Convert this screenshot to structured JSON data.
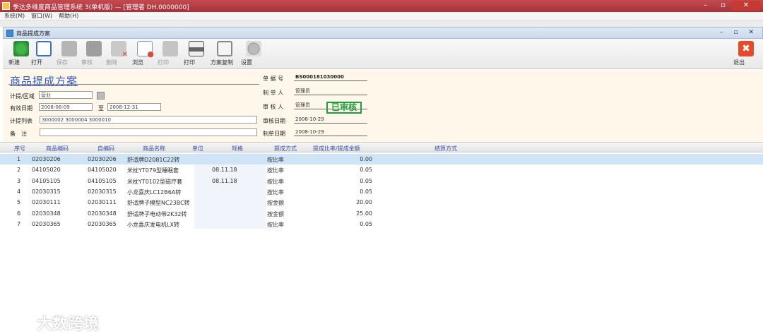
{
  "window": {
    "title": "季达多维度商品管理系统 3(单机版) — [管理者 DH.0000000]"
  },
  "menu": [
    "系统(M)",
    "窗口(W)",
    "帮助(H)"
  ],
  "subwindow": {
    "title": "商品提成方案",
    "controls": "– ▫ ✕"
  },
  "toolbar": {
    "buttons": [
      {
        "label": "新建",
        "icon": "new-doc-icon",
        "enabled": true
      },
      {
        "label": "打开",
        "icon": "open-doc-icon",
        "enabled": true
      },
      {
        "label": "保存",
        "icon": "save-icon",
        "enabled": false
      },
      {
        "label": "审核",
        "icon": "audit-icon",
        "enabled": false
      },
      {
        "label": "删除",
        "icon": "delete-icon",
        "enabled": false
      },
      {
        "label": "浏览",
        "icon": "browse-icon",
        "enabled": true
      },
      {
        "label": "打印",
        "icon": "print-disabled-icon",
        "enabled": false
      },
      {
        "label": "打印",
        "icon": "printer-icon",
        "enabled": true
      },
      {
        "label": "方案复制",
        "icon": "copy-scheme-icon",
        "enabled": true
      },
      {
        "label": "设置",
        "icon": "settings-icon",
        "enabled": true
      }
    ],
    "exit_label": "退出"
  },
  "form": {
    "doc_title": "商品提成方案",
    "labels": {
      "object": "计提/区域",
      "valid_date": "有效日期",
      "to": "至",
      "object_list": "计提列表",
      "remark": "备　注",
      "doc_no": "单 据 号",
      "maker": "制 单 人",
      "auditor": "审 核 人",
      "audit_date": "审核日期",
      "make_date": "制单日期"
    },
    "values": {
      "object": "营业",
      "date_from": "2008-06-09",
      "date_to": "2008-12-31",
      "object_list": "3000002 3000004 3000010",
      "remark": "",
      "doc_no": "BS000181030000",
      "maker": "管理员",
      "auditor": "管理员",
      "audit_date": "2008-10-29",
      "make_date": "2008-10-29"
    },
    "status_stamp": "已审核"
  },
  "grid": {
    "columns": [
      "序号",
      "商品编码",
      "自编码",
      "商品名称",
      "单位",
      "规格",
      "提成方式",
      "提成比率/提成金额",
      "结算方式"
    ],
    "rows": [
      [
        "1",
        "02030206",
        "02030206",
        "舒适牌D2081C22转",
        "",
        "",
        "按比率",
        "0.00"
      ],
      [
        "2",
        "04105020",
        "04105020",
        "米枕YT079型睡眠套",
        "",
        "08.11.18",
        "按比率",
        "0.05"
      ],
      [
        "3",
        "04105105",
        "04105105",
        "米枕YT0102型磁疗套",
        "",
        "08.11.18",
        "按比率",
        "0.05"
      ],
      [
        "4",
        "02030315",
        "02030315",
        "小龙喜庆LC12B6A转",
        "",
        "",
        "按比率",
        "0.05"
      ],
      [
        "5",
        "02030111",
        "02030111",
        "舒适牌子模型NC23BC转",
        "",
        "",
        "按金额",
        "20.00"
      ],
      [
        "6",
        "02030348",
        "02030348",
        "舒适牌子电动带2K32转",
        "",
        "",
        "按金额",
        "25.00"
      ],
      [
        "7",
        "02030365",
        "02030365",
        "小龙喜庆发电机LX转",
        "",
        "",
        "按比率",
        "0.05"
      ]
    ]
  },
  "watermark": {
    "text": "大数跨境"
  }
}
